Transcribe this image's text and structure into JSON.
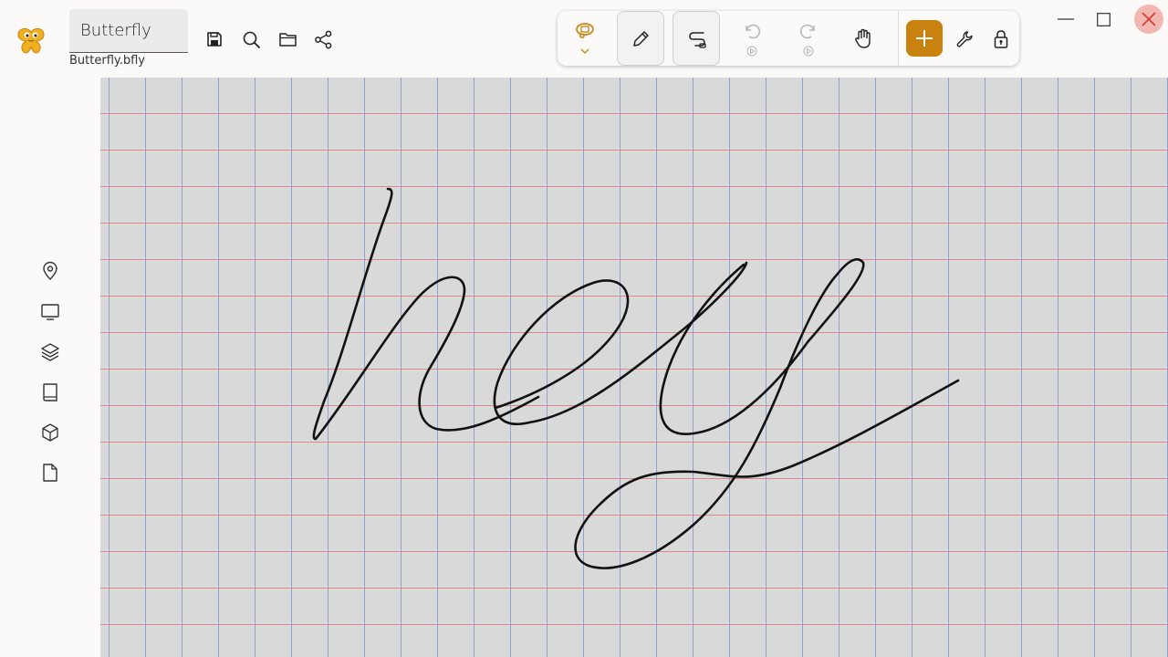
{
  "app": {
    "title": "Butterfly",
    "filename": "Butterfly.bfly",
    "accent_color": "#c98210"
  },
  "header": {
    "actions": [
      {
        "name": "save",
        "icon": "save-icon"
      },
      {
        "name": "search",
        "icon": "search-icon"
      },
      {
        "name": "open",
        "icon": "folder-icon"
      },
      {
        "name": "share",
        "icon": "share-icon"
      }
    ]
  },
  "toolbar": {
    "tools": [
      {
        "name": "lasso",
        "icon": "lasso-icon",
        "active": true
      },
      {
        "name": "pen",
        "icon": "pen-icon"
      },
      {
        "name": "path-eraser",
        "icon": "path-eraser-icon"
      },
      {
        "name": "undo",
        "icon": "undo-icon",
        "disabled": true
      },
      {
        "name": "redo",
        "icon": "redo-icon",
        "disabled": true
      },
      {
        "name": "hand",
        "icon": "hand-icon"
      },
      {
        "name": "add",
        "icon": "plus-icon"
      },
      {
        "name": "tools",
        "icon": "wrench-icon"
      },
      {
        "name": "lock",
        "icon": "lock-icon"
      }
    ]
  },
  "window_controls": [
    "minimize-icon",
    "maximize-icon",
    "close-icon"
  ],
  "sidebar": {
    "items": [
      {
        "name": "waypoints",
        "icon": "location-pin-icon"
      },
      {
        "name": "presentation",
        "icon": "monitor-icon"
      },
      {
        "name": "layers",
        "icon": "layers-icon"
      },
      {
        "name": "pages",
        "icon": "book-icon"
      },
      {
        "name": "packs",
        "icon": "cube-icon"
      },
      {
        "name": "files",
        "icon": "file-icon"
      }
    ]
  },
  "canvas": {
    "background": "quad-ruled",
    "handwriting": "hey"
  }
}
